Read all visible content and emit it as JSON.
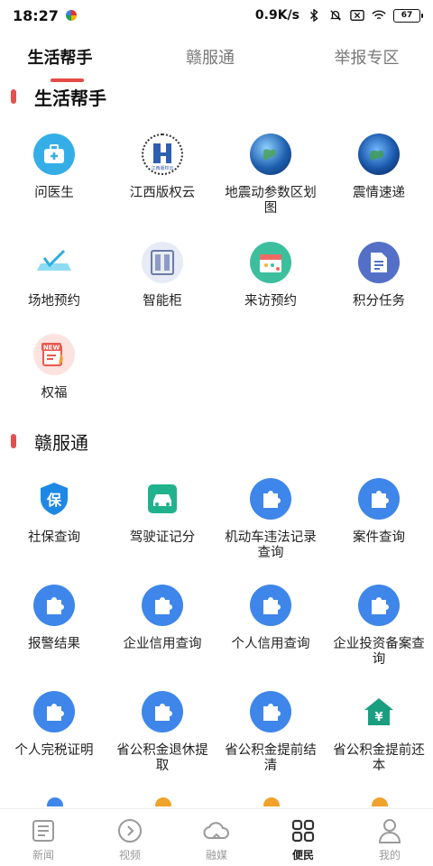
{
  "status_bar": {
    "time": "18:27",
    "speed": "0.9K/s",
    "battery": "67"
  },
  "tabs": [
    {
      "label": "生活帮手",
      "active": true
    },
    {
      "label": "赣服通",
      "active": false
    },
    {
      "label": "举报专区",
      "active": false
    }
  ],
  "sections": [
    {
      "title": "生活帮手",
      "items": [
        {
          "label": "问医生",
          "icon": "medical-kit-icon"
        },
        {
          "label": "江西版权云",
          "icon": "copyright-cloud-logo-icon",
          "logo_text": "江西版权云"
        },
        {
          "label": "地震动参数区划图",
          "icon": "earth-globe-icon"
        },
        {
          "label": "震情速递",
          "icon": "earth-globe-icon"
        },
        {
          "label": "场地预约",
          "icon": "venue-icon"
        },
        {
          "label": "智能柜",
          "icon": "locker-icon"
        },
        {
          "label": "来访预约",
          "icon": "calendar-icon"
        },
        {
          "label": "积分任务",
          "icon": "task-document-icon"
        },
        {
          "label": "权福",
          "icon": "new-badge-icon",
          "badge_text": "NEW"
        }
      ]
    },
    {
      "title": "赣服通",
      "items": [
        {
          "label": "社保查询",
          "icon": "social-security-shield-icon",
          "glyph": "保"
        },
        {
          "label": "驾驶证记分",
          "icon": "car-icon"
        },
        {
          "label": "机动车违法记录查询",
          "icon": "puzzle-icon"
        },
        {
          "label": "案件查询",
          "icon": "puzzle-icon"
        },
        {
          "label": "报警结果",
          "icon": "puzzle-icon"
        },
        {
          "label": "企业信用查询",
          "icon": "puzzle-icon"
        },
        {
          "label": "个人信用查询",
          "icon": "puzzle-icon"
        },
        {
          "label": "企业投资备案查询",
          "icon": "puzzle-icon"
        },
        {
          "label": "个人完税证明",
          "icon": "puzzle-icon"
        },
        {
          "label": "省公积金退休提取",
          "icon": "puzzle-icon"
        },
        {
          "label": "省公积金提前结清",
          "icon": "puzzle-icon"
        },
        {
          "label": "省公积金提前还本",
          "icon": "housing-fund-icon",
          "glyph": "¥"
        }
      ]
    }
  ],
  "bottom_nav": [
    {
      "label": "新闻",
      "icon": "news-icon",
      "active": false
    },
    {
      "label": "视频",
      "icon": "video-play-icon",
      "active": false
    },
    {
      "label": "融媒",
      "icon": "cloud-icon",
      "active": false
    },
    {
      "label": "便民",
      "icon": "grid-apps-icon",
      "active": true
    },
    {
      "label": "我的",
      "icon": "user-icon",
      "active": false
    }
  ],
  "colors": {
    "accent": "#e54b45",
    "blue": "#3e86ea",
    "teal": "#2eb39c"
  }
}
